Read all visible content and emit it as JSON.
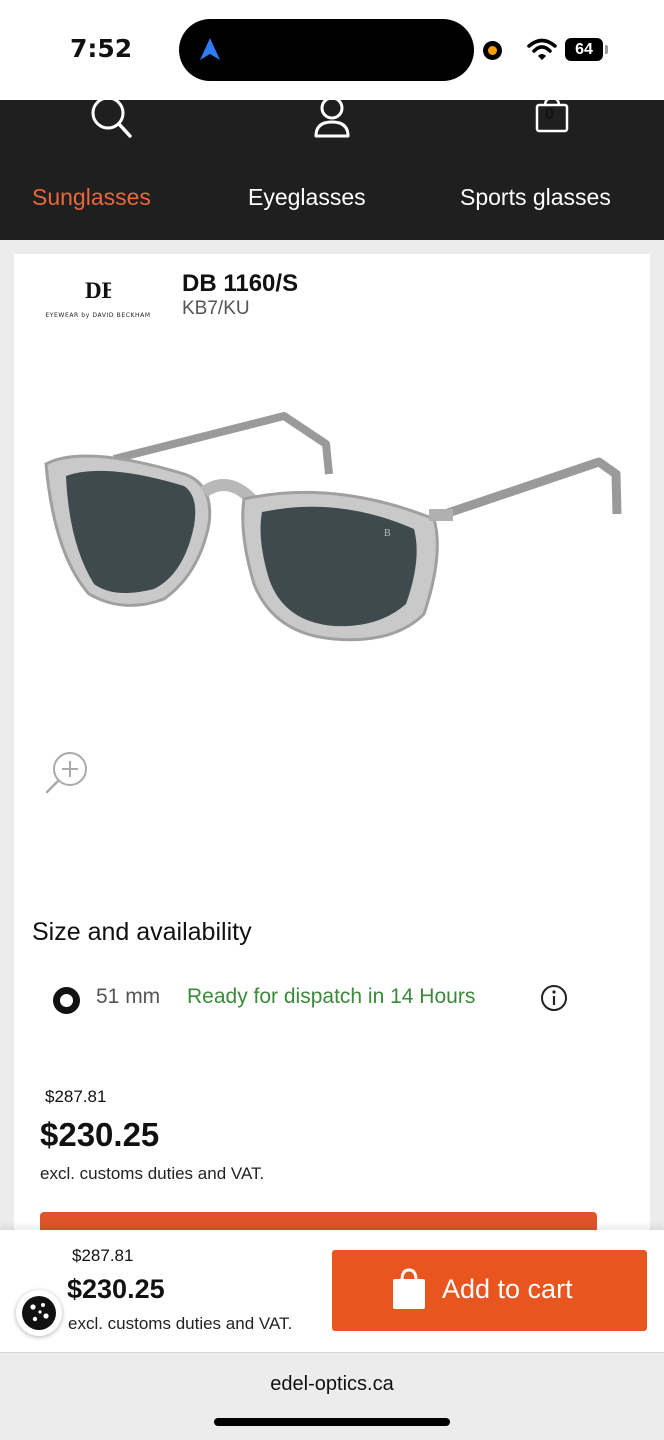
{
  "status": {
    "time": "7:52",
    "battery": "64"
  },
  "header": {
    "tabs": [
      {
        "label": "Sunglasses",
        "active": true
      },
      {
        "label": "Eyeglasses",
        "active": false
      },
      {
        "label": "Sports glasses",
        "active": false
      }
    ],
    "cart_count": "0",
    "accent_color": "#e8683a"
  },
  "product": {
    "brand": "EYEWEAR by DAVID BECKHAM",
    "brand_mark": "DB",
    "name": "DB 1160/S",
    "code": "KB7/KU"
  },
  "availability": {
    "heading": "Size and availability",
    "size": "51 mm",
    "status": "Ready for dispatch in 14 Hours",
    "status_color": "#3a8a3a"
  },
  "pricing": {
    "old_price": "$287.81",
    "price": "$230.25",
    "note": "excl. customs duties and VAT."
  },
  "sticky": {
    "old_price": "$287.81",
    "price": "$230.25",
    "note": "excl. customs duties and VAT.",
    "add_to_cart": "Add to cart",
    "button_color": "#e8551f"
  },
  "browser": {
    "url": "edel-optics.ca"
  }
}
